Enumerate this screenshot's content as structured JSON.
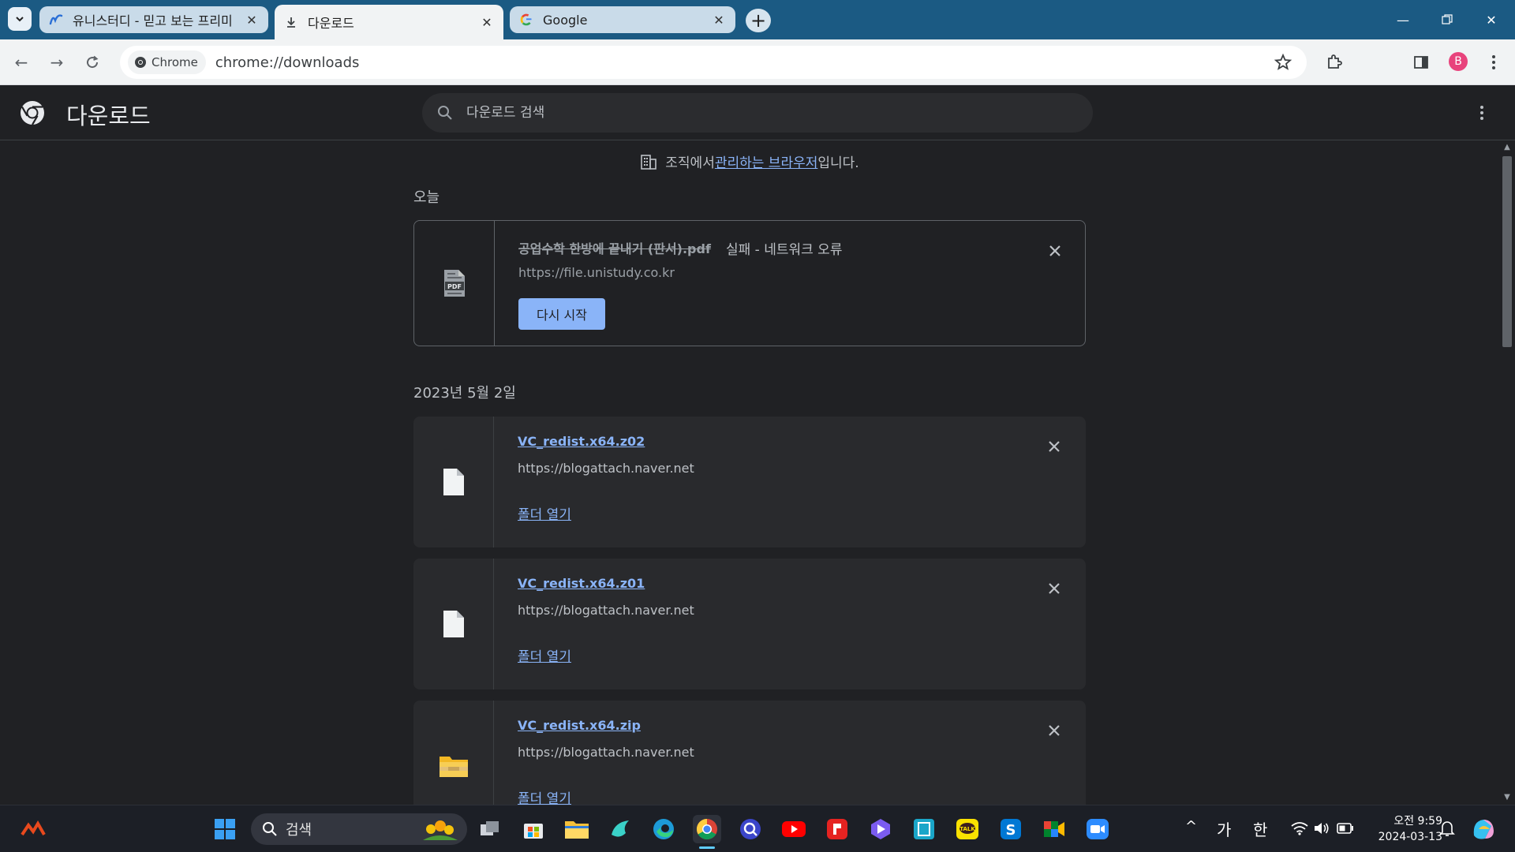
{
  "tabs": [
    {
      "title": "유니스터디 - 믿고 보는 프리미",
      "icon": "unistudy-favicon"
    },
    {
      "title": "다운로드",
      "icon": "download-icon"
    },
    {
      "title": "Google",
      "icon": "google-favicon"
    }
  ],
  "toolbar": {
    "chip_label": "Chrome",
    "url": "chrome://downloads",
    "profile_initial": "B"
  },
  "downloads_page": {
    "title": "다운로드",
    "search_placeholder": "다운로드 검색",
    "managed_prefix": "조직에서 ",
    "managed_link": "관리하는 브라우저",
    "managed_suffix": "입니다."
  },
  "groups": [
    {
      "date": "오늘",
      "items": [
        {
          "filename": "공업수학 한방에 끝내기 (판서).pdf",
          "status": "실패 - 네트워크 오류",
          "source": "https://file.unistudy.co.kr",
          "action": "다시 시작",
          "icon": "pdf-icon"
        }
      ]
    },
    {
      "date": "2023년 5월 2일",
      "items": [
        {
          "filename": "VC_redist.x64.z02",
          "source": "https://blogattach.naver.net",
          "action": "폴더 열기",
          "icon": "file-icon"
        },
        {
          "filename": "VC_redist.x64.z01",
          "source": "https://blogattach.naver.net",
          "action": "폴더 열기",
          "icon": "file-icon"
        },
        {
          "filename": "VC_redist.x64.zip",
          "source": "https://blogattach.naver.net",
          "action": "폴더 열기",
          "icon": "zip-folder-icon"
        }
      ]
    }
  ],
  "taskbar": {
    "search_label": "검색",
    "ime_lang": "가",
    "ime_mode": "한",
    "time": "오전 9:59",
    "date": "2024-03-13"
  },
  "colors": {
    "tabstrip": "#1b5a83",
    "page_bg": "#202124",
    "card_bg": "#292a2d",
    "link": "#8ab4f8"
  }
}
